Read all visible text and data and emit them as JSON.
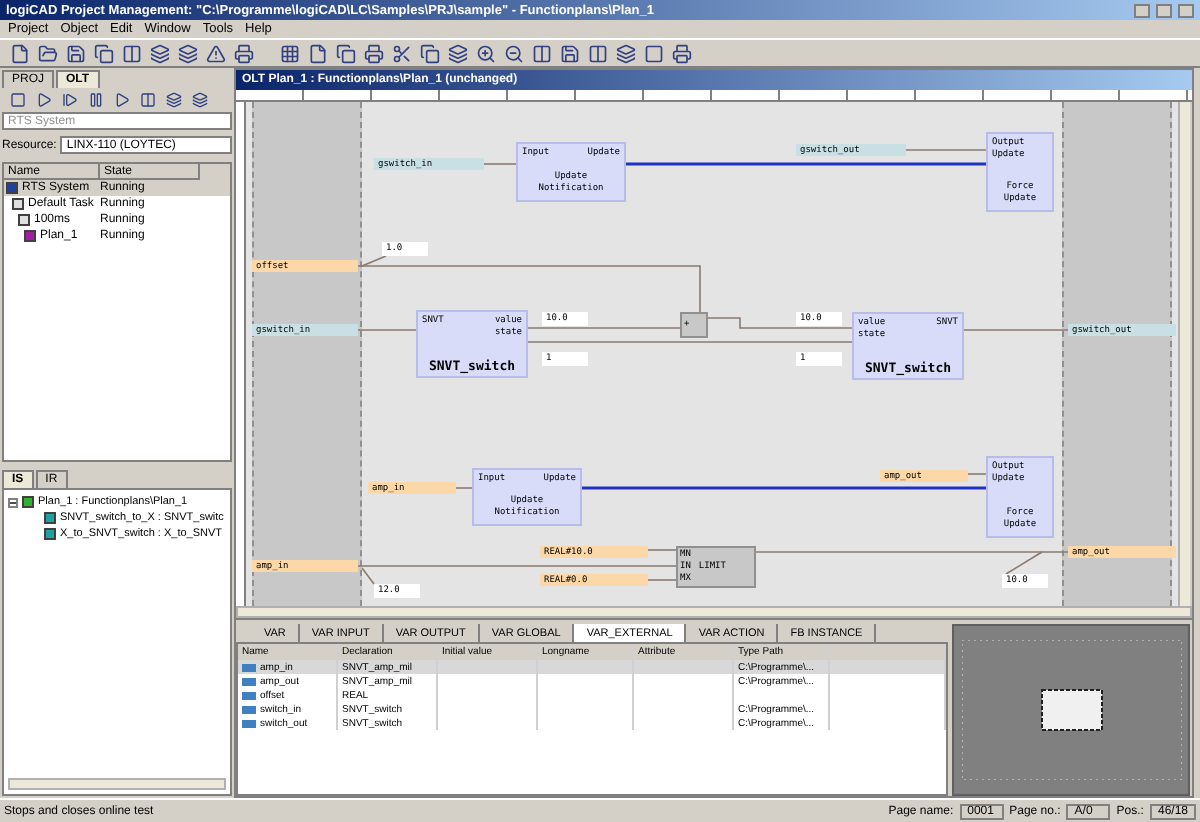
{
  "window": {
    "title": "logiCAD Project Management: \"C:\\Programme\\logiCAD\\LC\\Samples\\PRJ\\sample\" - Functionplans\\Plan_1"
  },
  "menu": [
    "Project",
    "Object",
    "Edit",
    "Window",
    "Tools",
    "Help"
  ],
  "left_panel": {
    "tabs": [
      {
        "label": "PROJ",
        "selected": false
      },
      {
        "label": "OLT",
        "selected": true
      }
    ],
    "system_field": {
      "placeholder": "RTS System"
    },
    "resource": {
      "label": "Resource:",
      "value": "LINX-110 (LOYTEC)"
    },
    "columns": [
      "Name",
      "State"
    ],
    "tasks": [
      {
        "name": "RTS System",
        "state": "Running",
        "kind": "system",
        "selected": true,
        "children": [
          {
            "name": "Default Task",
            "state": "Running",
            "kind": "task",
            "selected": false,
            "children": [
              {
                "name": "100ms",
                "state": "Running",
                "kind": "timer",
                "selected": false,
                "children": [
                  {
                    "name": "Plan_1",
                    "state": "Running",
                    "kind": "program",
                    "selected": false
                  }
                ]
              }
            ]
          }
        ]
      }
    ],
    "bottom_tabs": [
      {
        "label": "IS",
        "selected": true
      },
      {
        "label": "IR",
        "selected": false
      }
    ],
    "tree": [
      {
        "label": "Plan_1 : Functionplans\\Plan_1",
        "kind": "plan",
        "expanded": true,
        "children": [
          {
            "label": "SNVT_switch_to_X : SNVT_switc",
            "kind": "fb"
          },
          {
            "label": "X_to_SNVT_switch : X_to_SNVT",
            "kind": "fb"
          }
        ]
      }
    ]
  },
  "editor": {
    "title": "OLT Plan_1 : Functionplans\\Plan_1 (unchanged)",
    "variables": [
      {
        "name": "gswitch_in",
        "color": "#c8e0e4"
      },
      {
        "name": "gswitch_out",
        "color": "#c8e0e4"
      },
      {
        "name": "offset",
        "color": "#fcd8a8"
      },
      {
        "name": "gswitch_in",
        "color": "#c8e0e4"
      },
      {
        "name": "gswitch_out",
        "color": "#c8e0e4"
      },
      {
        "name": "amp_in",
        "color": "#fcd8a8"
      },
      {
        "name": "amp_out",
        "color": "#fcd8a8"
      },
      {
        "name": "REAL#10.0",
        "color": "#fcd8a8"
      },
      {
        "name": "REAL#0.0",
        "color": "#fcd8a8"
      },
      {
        "name": "amp_in",
        "color": "#fcd8a8"
      },
      {
        "name": "amp_out",
        "color": "#fcd8a8"
      }
    ],
    "constants": [
      "1.0",
      "10.0",
      "1",
      "10.0",
      "1",
      "12.0",
      "10.0"
    ],
    "blocks": [
      {
        "kind": "fb",
        "inputs": [
          "Input"
        ],
        "outputs": [
          "Update"
        ],
        "name": "Update Notification"
      },
      {
        "kind": "fb",
        "inputs": [
          "Output",
          "Update"
        ],
        "name": "Force Update"
      },
      {
        "kind": "fb",
        "inputs": [
          "SNVT"
        ],
        "outputs": [
          "value",
          "state"
        ],
        "name": "SNVT_switch"
      },
      {
        "kind": "function",
        "name": "+"
      },
      {
        "kind": "fb",
        "inputs": [
          "value",
          "state"
        ],
        "outputs": [
          "SNVT"
        ],
        "name": "SNVT_switch"
      },
      {
        "kind": "fb",
        "inputs": [
          "Input"
        ],
        "outputs": [
          "Update"
        ],
        "name": "Update Notification"
      },
      {
        "kind": "fb",
        "inputs": [
          "Output",
          "Update"
        ],
        "name": "Force Update"
      },
      {
        "kind": "function",
        "inputs": [
          "MN",
          "IN",
          "MX"
        ],
        "name": "LIMIT"
      }
    ],
    "var_tabs": [
      {
        "label": "VAR",
        "selected": false
      },
      {
        "label": "VAR INPUT",
        "selected": false
      },
      {
        "label": "VAR OUTPUT",
        "selected": false
      },
      {
        "label": "VAR GLOBAL",
        "selected": false
      },
      {
        "label": "VAR_EXTERNAL",
        "selected": true
      },
      {
        "label": "VAR ACTION",
        "selected": false
      },
      {
        "label": "FB INSTANCE",
        "selected": false
      }
    ],
    "var_table": {
      "columns": [
        "Name",
        "Declaration",
        "Initial value",
        "Longname",
        "Attribute",
        "Type Path"
      ],
      "rows": [
        {
          "name": "amp_in",
          "declaration": "SNVT_amp_mil",
          "type_path": "C:\\Programme\\...",
          "selected": true
        },
        {
          "name": "amp_out",
          "declaration": "SNVT_amp_mil",
          "type_path": "C:\\Programme\\...",
          "selected": false
        },
        {
          "name": "offset",
          "declaration": "REAL",
          "selected": false
        },
        {
          "name": "switch_in",
          "declaration": "SNVT_switch",
          "type_path": "C:\\Programme\\...",
          "selected": false
        },
        {
          "name": "switch_out",
          "declaration": "SNVT_switch",
          "type_path": "C:\\Programme\\...",
          "selected": false
        }
      ]
    }
  },
  "status_bar": {
    "message": "Stops and closes online test",
    "fields": [
      {
        "label": "Page name:",
        "value": "0001"
      },
      {
        "label": "Page no.:",
        "value": "A/0"
      },
      {
        "label": "Pos.:",
        "value": "46/18"
      }
    ]
  }
}
